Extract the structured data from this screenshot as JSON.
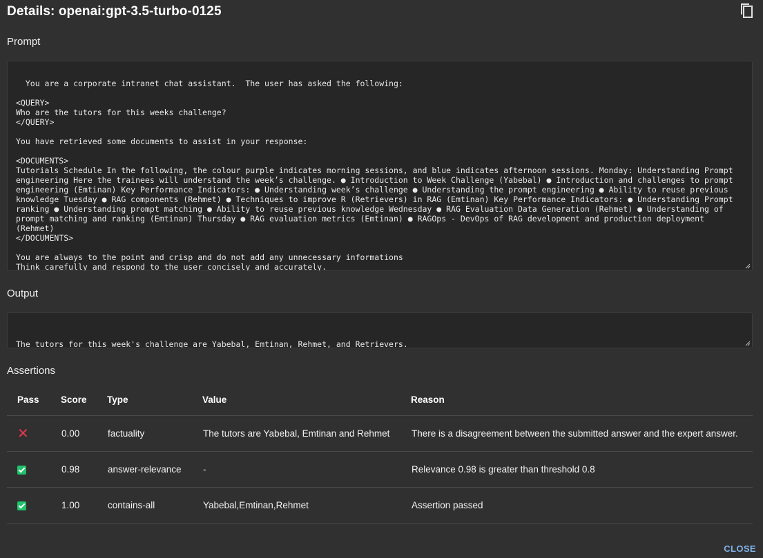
{
  "dialog": {
    "title": "Details: openai:gpt-3.5-turbo-0125",
    "copy_icon": "copy-icon",
    "close_label": "CLOSE",
    "accent_color": "#7fb3e8"
  },
  "prompt": {
    "label": "Prompt",
    "text": "You are a corporate intranet chat assistant.  The user has asked the following:\n\n<QUERY>\nWho are the tutors for this weeks challenge?\n</QUERY>\n\nYou have retrieved some documents to assist in your response:\n\n<DOCUMENTS>\nTutorials Schedule In the following, the colour purple indicates morning sessions, and blue indicates afternoon sessions. Monday: Understanding Prompt engineering Here the trainees will understand the week’s challenge. ● Introduction to Week Challenge (Yabebal) ● Introduction and challenges to prompt engineering (Emtinan) Key Performance Indicators: ● Understanding week’s challenge ● Understanding the prompt engineering ● Ability to reuse previous knowledge Tuesday ● RAG components (Rehmet) ● Techniques to improve R (Retrievers) in RAG (Emtinan) Key Performance Indicators: ● Understanding Prompt ranking ● Understanding prompt matching ● Ability to reuse previous knowledge Wednesday ● RAG Evaluation Data Generation (Rehmet) ● Understanding of prompt matching and ranking (Emtinan) Thursday ● RAG evaluation metrics (Emtinan) ● RAGOps - DevOps of RAG development and production deployment (Rehmet)\n</DOCUMENTS>\n\nYou are always to the point and crisp and do not add any unnecessary informations\nThink carefully and respond to the user concisely and accurately.\nFor each statement you output only what the QUERY asked only"
  },
  "output": {
    "label": "Output",
    "text": "\nThe tutors for this week's challenge are Yabebal, Emtinan, Rehmet, and Retrievers."
  },
  "assertions": {
    "label": "Assertions",
    "columns": [
      "Pass",
      "Score",
      "Type",
      "Value",
      "Reason"
    ],
    "rows": [
      {
        "pass": false,
        "pass_icon": "fail-x-icon",
        "score": "0.00",
        "type": "factuality",
        "value": "The tutors are Yabebal, Emtinan and Rehmet",
        "reason": "There is a disagreement between the submitted answer and the expert answer."
      },
      {
        "pass": true,
        "pass_icon": "pass-check-icon",
        "score": "0.98",
        "type": "answer-relevance",
        "value": "-",
        "reason": "Relevance 0.98 is greater than threshold 0.8"
      },
      {
        "pass": true,
        "pass_icon": "pass-check-icon",
        "score": "1.00",
        "type": "contains-all",
        "value": "Yabebal,Emtinan,Rehmet",
        "reason": "Assertion passed"
      }
    ],
    "fail_color": "#e53950",
    "pass_color": "#20c26a"
  }
}
